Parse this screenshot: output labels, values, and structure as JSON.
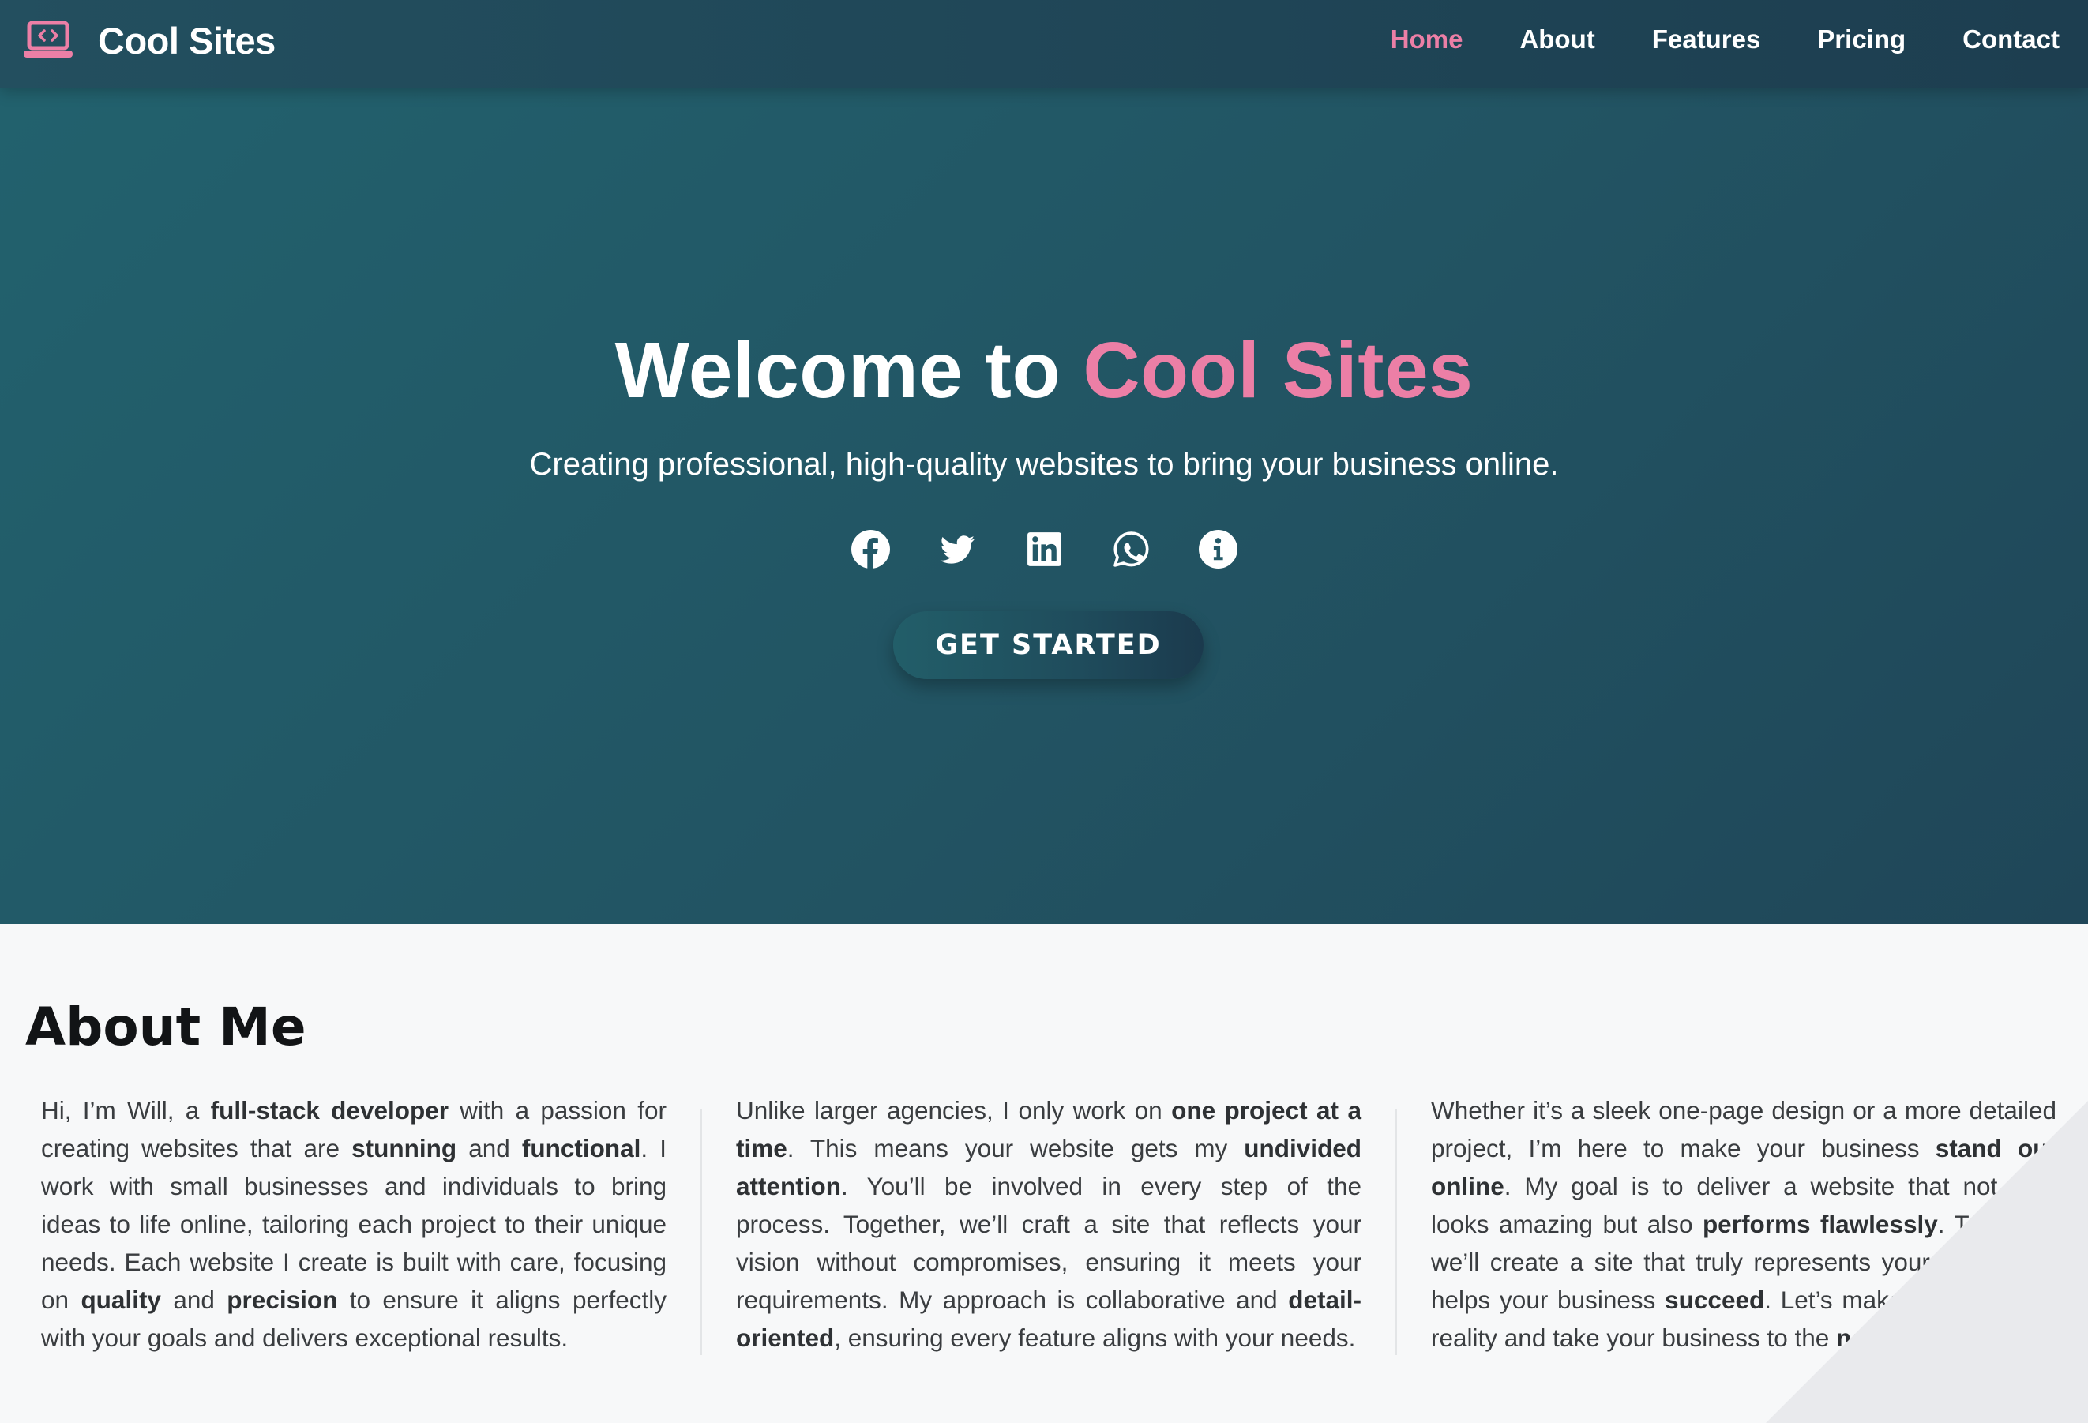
{
  "colors": {
    "accent": "#ec7fa6",
    "hero_background": "#225463",
    "navbar": "#1f4556",
    "page_background": "#f7f8f9"
  },
  "navbar": {
    "brand_icon": "laptop-code-icon",
    "brand_name": "Cool Sites",
    "links": [
      {
        "label": "Home",
        "active": true
      },
      {
        "label": "About",
        "active": false
      },
      {
        "label": "Features",
        "active": false
      },
      {
        "label": "Pricing",
        "active": false
      },
      {
        "label": "Contact",
        "active": false
      }
    ]
  },
  "hero": {
    "title_prefix": "Welcome to ",
    "title_accent": "Cool Sites",
    "subtitle": "Creating professional, high-quality websites to bring your business online.",
    "social_icons": [
      "facebook-icon",
      "twitter-icon",
      "linkedin-icon",
      "whatsapp-icon",
      "info-icon"
    ],
    "cta_label": "GET STARTED"
  },
  "about": {
    "title": "About Me",
    "columns": [
      [
        {
          "t": "Hi, I’m Will, a "
        },
        {
          "t": "full-stack developer",
          "b": true
        },
        {
          "t": " with a passion for creating websites that are "
        },
        {
          "t": "stunning",
          "b": true
        },
        {
          "t": " and "
        },
        {
          "t": "functional",
          "b": true
        },
        {
          "t": ". I work with small businesses and individuals to bring ideas to life online, tailoring each project to their unique needs. Each website I create is built with care, focusing on "
        },
        {
          "t": "quality",
          "b": true
        },
        {
          "t": " and "
        },
        {
          "t": "precision",
          "b": true
        },
        {
          "t": " to ensure it aligns perfectly with your goals and delivers exceptional results."
        }
      ],
      [
        {
          "t": "Unlike larger agencies, I only work on "
        },
        {
          "t": "one project at a time",
          "b": true
        },
        {
          "t": ". This means your website gets my "
        },
        {
          "t": "undivided attention",
          "b": true
        },
        {
          "t": ". You’ll be involved in every step of the process. Together, we’ll craft a site that reflects your vision without compromises, ensuring it meets your requirements. My approach is collaborative and "
        },
        {
          "t": "detail-oriented",
          "b": true
        },
        {
          "t": ", ensuring every feature aligns with your needs."
        }
      ],
      [
        {
          "t": "Whether it’s a sleek one-page design or a more detailed project, I’m here to make your business "
        },
        {
          "t": "stand out online",
          "b": true
        },
        {
          "t": ". My goal is to deliver a website that not only looks amazing but also "
        },
        {
          "t": "performs flawlessly",
          "b": true
        },
        {
          "t": ". Together, we’ll create a site that truly represents your brand and helps your business "
        },
        {
          "t": "succeed",
          "b": true
        },
        {
          "t": ". Let’s make your vision a reality and take your business to the "
        },
        {
          "t": "next level",
          "b": true
        },
        {
          "t": "."
        }
      ]
    ]
  }
}
